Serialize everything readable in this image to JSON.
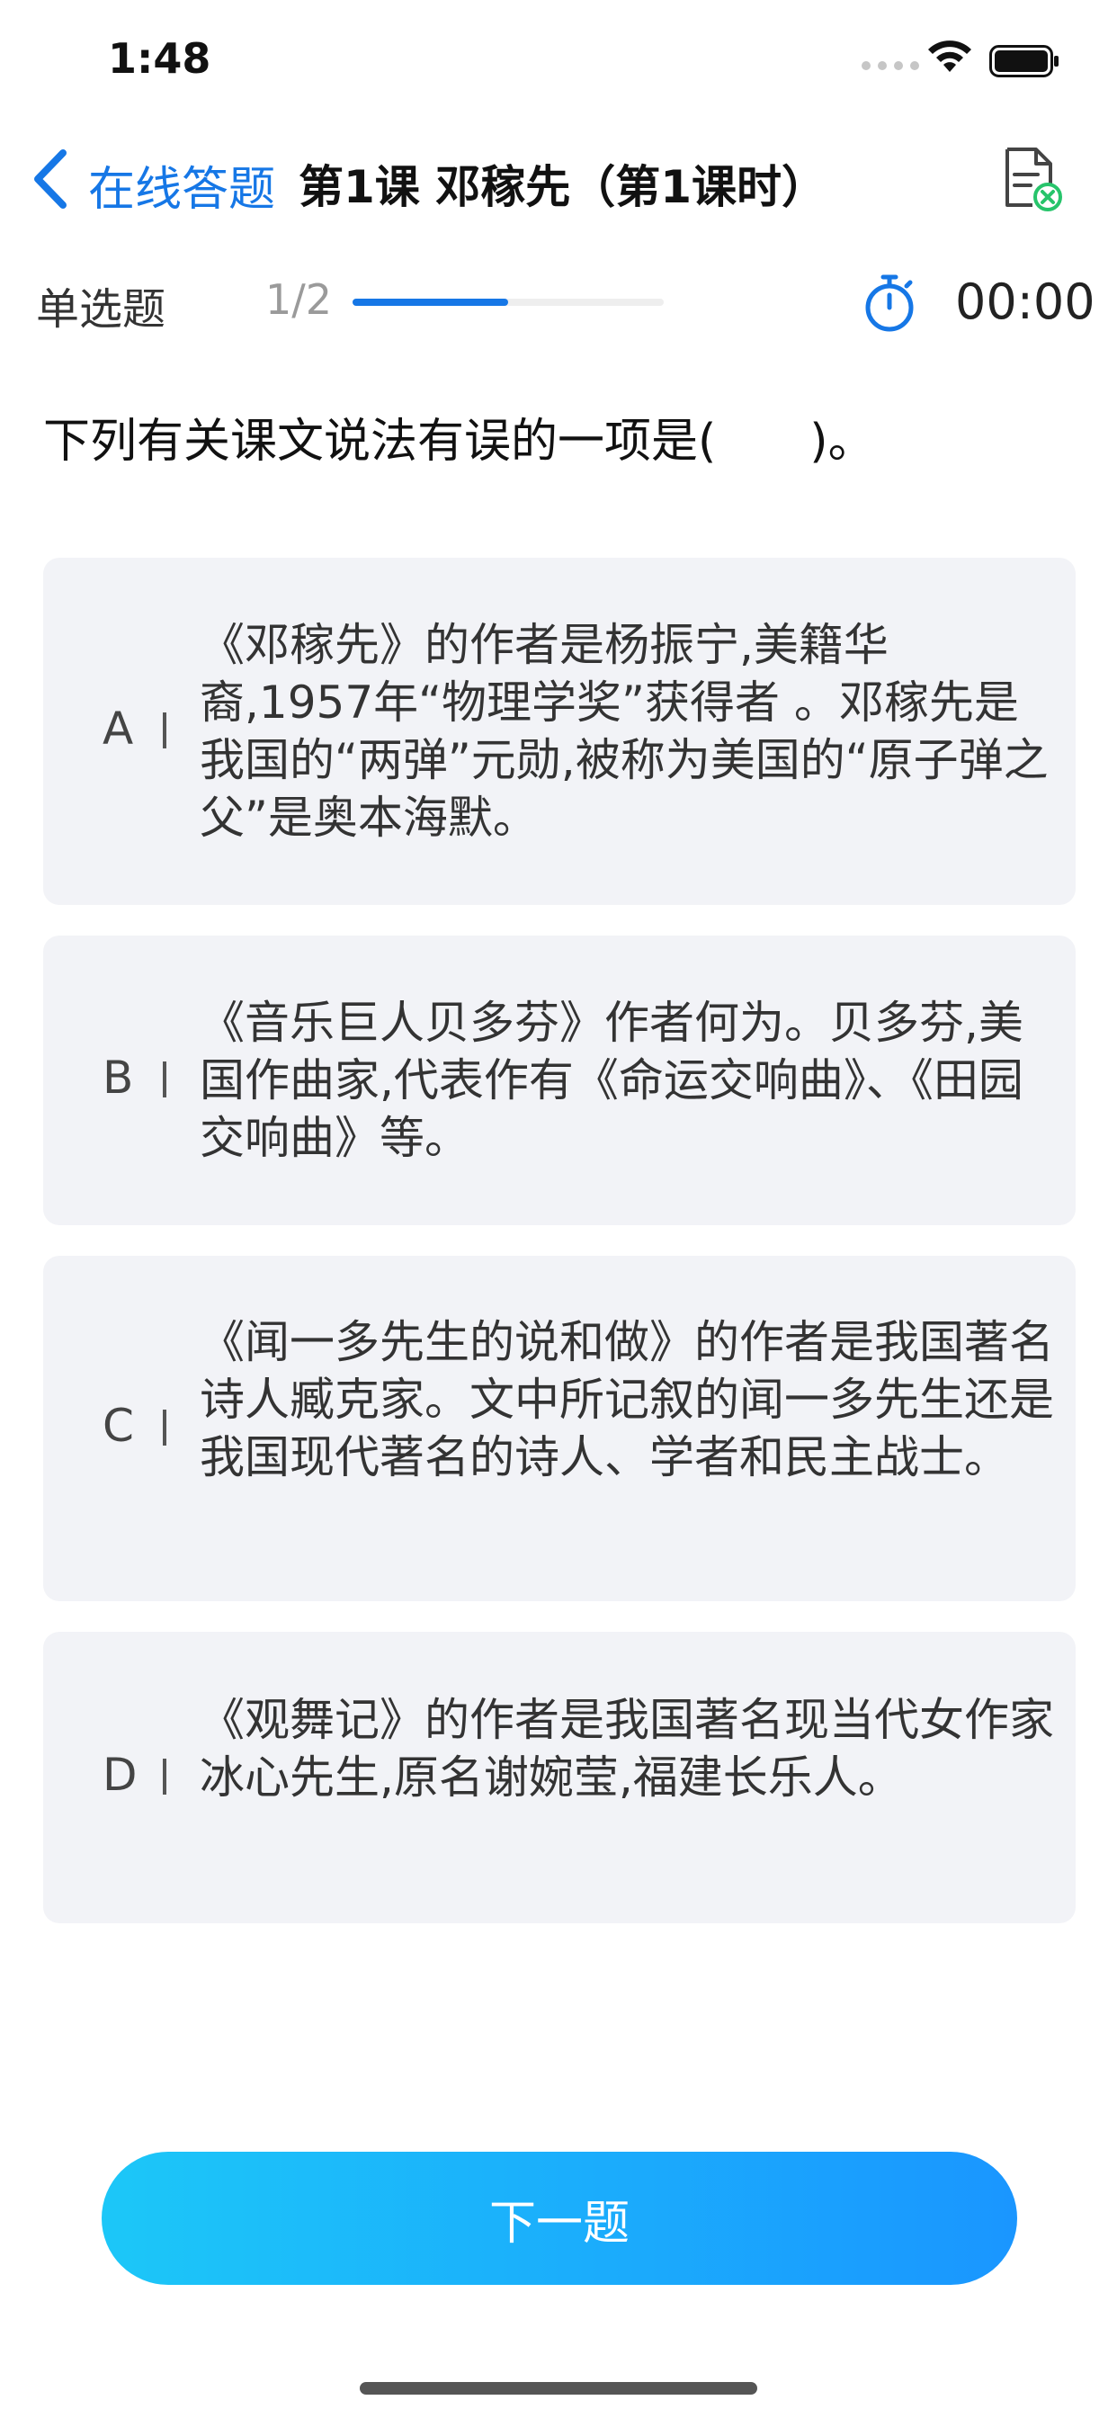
{
  "status_bar": {
    "time": "1:48"
  },
  "nav": {
    "back_label": "在线答题",
    "title": "第1课 邓稼先（第1课时）"
  },
  "progress": {
    "question_type": "单选题",
    "count_text": "1/2",
    "fraction": 0.5,
    "timer": "00:00"
  },
  "question": {
    "text": "下列有关课文说法有误的一项是(　　)。"
  },
  "options": [
    {
      "letter": "A",
      "text": "《邓稼先》的作者是杨振宁,美籍华裔,1957年“物理学奖”获得者 。邓稼先是我国的“两弹”元勋,被称为美国的“原子弹之父”是奥本海默。"
    },
    {
      "letter": "B",
      "text": "《音乐巨人贝多芬》作者何为。贝多芬,美国作曲家,代表作有《命运交响曲》、《田园交响曲》等。"
    },
    {
      "letter": "C",
      "text": "《闻一多先生的说和做》的作者是我国著名诗人臧克家。文中所记叙的闻一多先生还是我国现代著名的诗人、学者和民主战士。"
    },
    {
      "letter": "D",
      "text": "《观舞记》的作者是我国著名现当代女作家冰心先生,原名谢婉莹,福建长乐人。"
    }
  ],
  "footer": {
    "next_label": "下一题"
  },
  "colors": {
    "accent": "#1677e6",
    "option_bg": "#f2f3f7",
    "button_start": "#1cc7f8",
    "button_end": "#1a96ff",
    "icon_green": "#27c46b"
  },
  "icons": {
    "back": "chevron-left-icon",
    "answer_sheet": "answer-sheet-icon",
    "timer": "stopwatch-icon",
    "wifi": "wifi-icon",
    "battery": "battery-icon",
    "signal": "signal-icon"
  }
}
